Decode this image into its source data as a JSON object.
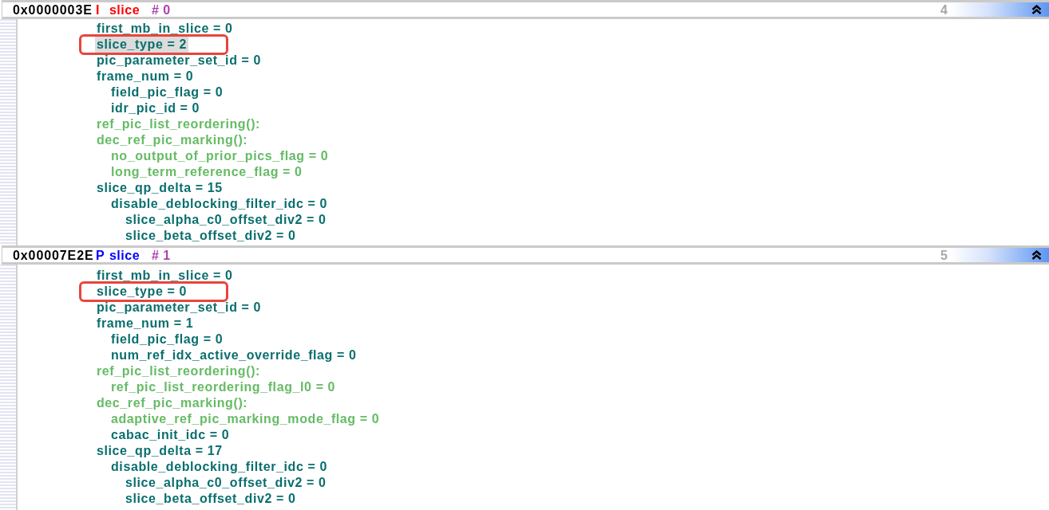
{
  "slices": [
    {
      "offset": "0x0000003E",
      "type": "I",
      "label": "slice",
      "color": "#ff0000",
      "index": "# 0",
      "counter": "4",
      "expanded": true,
      "lines": [
        {
          "text": "first_mb_in_slice = 0",
          "color": "#0a6e6e",
          "selected": false,
          "annotated": false
        },
        {
          "text": "slice_type = 2",
          "color": "#0a6e6e",
          "selected": true,
          "annotated": true
        },
        {
          "text": "pic_parameter_set_id = 0",
          "color": "#0a6e6e",
          "selected": false,
          "annotated": false
        },
        {
          "text": "frame_num = 0",
          "color": "#0a6e6e",
          "selected": false,
          "annotated": false,
          "children": [
            {
              "text": "field_pic_flag = 0",
              "color": "#0a6e6e",
              "selected": false,
              "annotated": false
            },
            {
              "text": "idr_pic_id = 0",
              "color": "#0a6e6e",
              "selected": false,
              "annotated": false
            }
          ]
        },
        {
          "text": "ref_pic_list_reordering():",
          "color": "#66bb66",
          "selected": false,
          "annotated": false
        },
        {
          "text": "dec_ref_pic_marking():",
          "color": "#66bb66",
          "selected": false,
          "annotated": false,
          "children": [
            {
              "text": "no_output_of_prior_pics_flag = 0",
              "color": "#66bb66",
              "selected": false,
              "annotated": false
            },
            {
              "text": "long_term_reference_flag = 0",
              "color": "#66bb66",
              "selected": false,
              "annotated": false
            }
          ]
        },
        {
          "text": "slice_qp_delta = 15",
          "color": "#0a6e6e",
          "selected": false,
          "annotated": false,
          "children": [
            {
              "text": "disable_deblocking_filter_idc = 0",
              "color": "#0a6e6e",
              "selected": false,
              "annotated": false,
              "children": [
                {
                  "text": "slice_alpha_c0_offset_div2 = 0",
                  "color": "#0a6e6e",
                  "selected": false,
                  "annotated": false
                },
                {
                  "text": "slice_beta_offset_div2 = 0",
                  "color": "#0a6e6e",
                  "selected": false,
                  "annotated": false
                }
              ]
            }
          ]
        }
      ]
    },
    {
      "offset": "0x00007E2E",
      "type": "P",
      "label": "slice",
      "color": "#0000ff",
      "index": "# 1",
      "counter": "5",
      "expanded": true,
      "lines": [
        {
          "text": "first_mb_in_slice = 0",
          "color": "#0a6e6e",
          "selected": false,
          "annotated": false
        },
        {
          "text": "slice_type = 0",
          "color": "#0a6e6e",
          "selected": false,
          "annotated": true
        },
        {
          "text": "pic_parameter_set_id = 0",
          "color": "#0a6e6e",
          "selected": false,
          "annotated": false
        },
        {
          "text": "frame_num = 1",
          "color": "#0a6e6e",
          "selected": false,
          "annotated": false,
          "children": [
            {
              "text": "field_pic_flag = 0",
              "color": "#0a6e6e",
              "selected": false,
              "annotated": false
            },
            {
              "text": "num_ref_idx_active_override_flag = 0",
              "color": "#0a6e6e",
              "selected": false,
              "annotated": false
            }
          ]
        },
        {
          "text": "ref_pic_list_reordering():",
          "color": "#66bb66",
          "selected": false,
          "annotated": false,
          "children": [
            {
              "text": "ref_pic_list_reordering_flag_l0 = 0",
              "color": "#66bb66",
              "selected": false,
              "annotated": false
            }
          ]
        },
        {
          "text": "dec_ref_pic_marking():",
          "color": "#66bb66",
          "selected": false,
          "annotated": false,
          "children": [
            {
              "text": "adaptive_ref_pic_marking_mode_flag = 0",
              "color": "#66bb66",
              "selected": false,
              "annotated": false
            },
            {
              "text": "cabac_init_idc = 0",
              "color": "#0a6e6e",
              "selected": false,
              "annotated": false
            }
          ]
        },
        {
          "text": "slice_qp_delta = 17",
          "color": "#0a6e6e",
          "selected": false,
          "annotated": false,
          "children": [
            {
              "text": "disable_deblocking_filter_idc = 0",
              "color": "#0a6e6e",
              "selected": false,
              "annotated": false,
              "children": [
                {
                  "text": "slice_alpha_c0_offset_div2 = 0",
                  "color": "#0a6e6e",
                  "selected": false,
                  "annotated": false
                },
                {
                  "text": "slice_beta_offset_div2 = 0",
                  "color": "#0a6e6e",
                  "selected": false,
                  "annotated": false
                }
              ]
            }
          ]
        }
      ]
    }
  ]
}
